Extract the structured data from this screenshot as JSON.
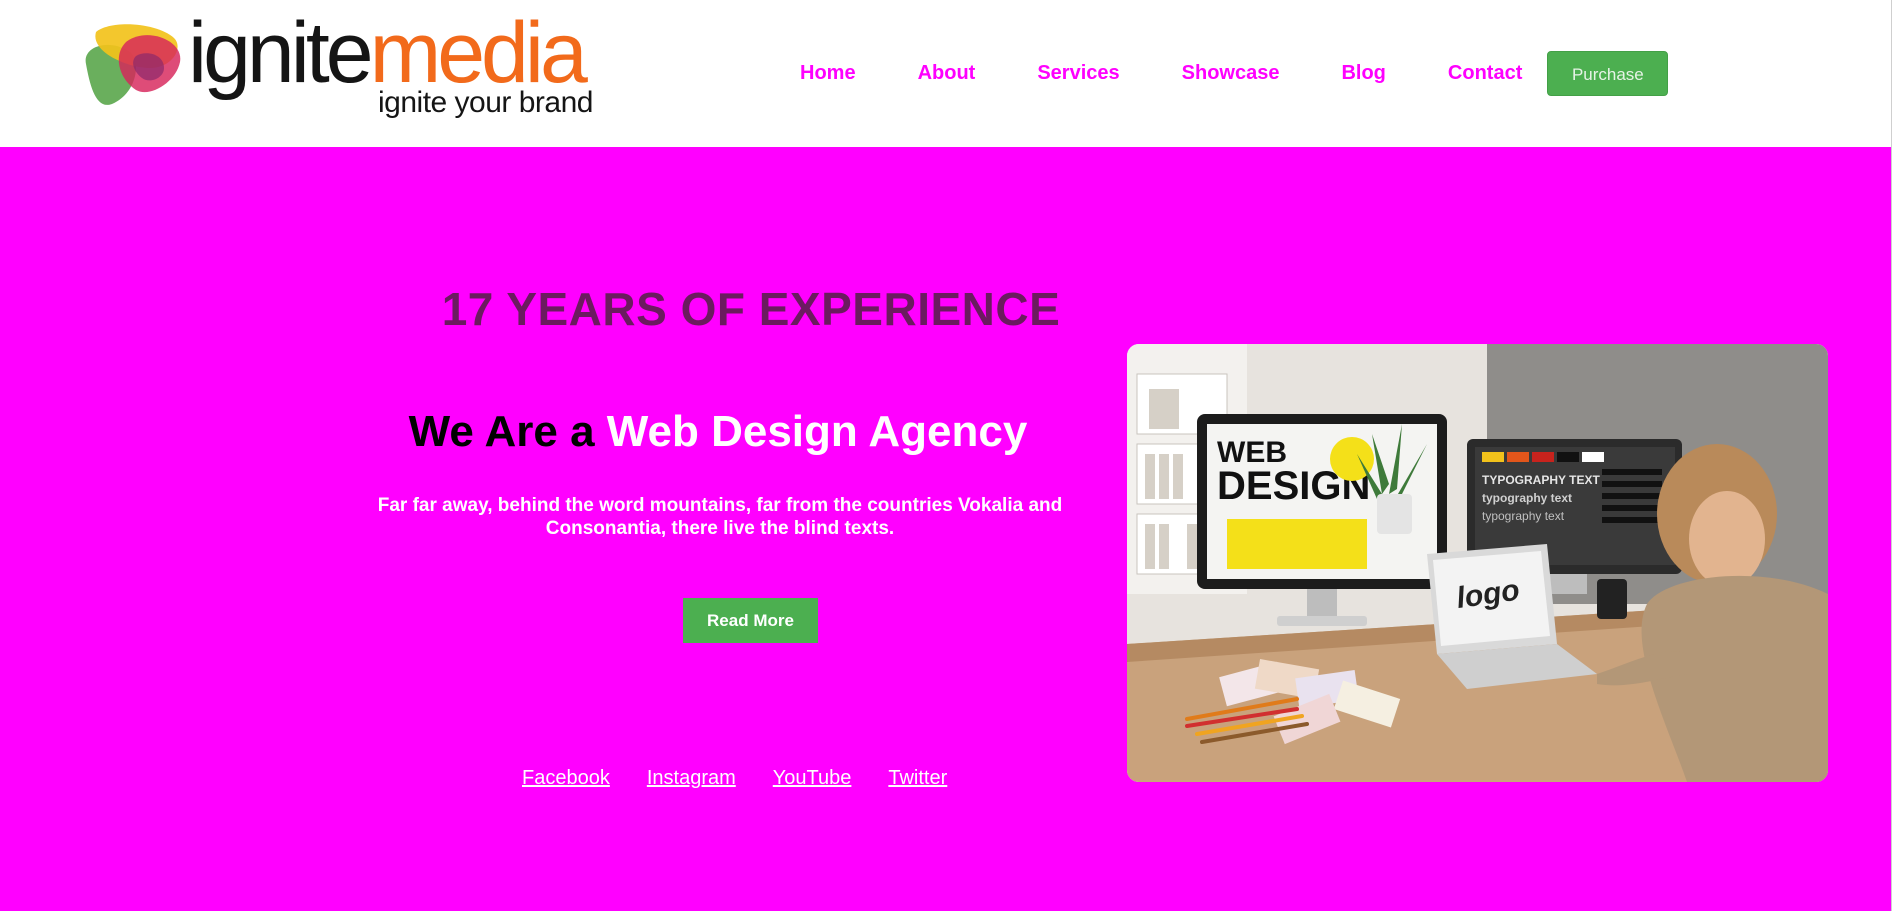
{
  "brand": {
    "name_part1": "ignite",
    "name_part2": "media",
    "tagline": "ignite your brand"
  },
  "nav": {
    "items": [
      "Home",
      "About",
      "Services",
      "Showcase",
      "Blog",
      "Contact"
    ],
    "purchase_label": "Purchase"
  },
  "hero": {
    "experience": "17 YEARS OF EXPERIENCE",
    "headline_dark": "We Are a",
    "headline_light": "Web Design Agency",
    "blurb": "Far far away, behind the word mountains, far from the countries Vokalia and Consonantia, there live the blind texts.",
    "read_more_label": "Read More",
    "social": [
      "Facebook",
      "Instagram",
      "YouTube",
      "Twitter"
    ]
  },
  "image": {
    "monitor_title_1": "WEB",
    "monitor_title_2": "DESIGN",
    "monitor2_line1": "TYPOGRAPHY TEXT",
    "monitor2_line2": "typography text",
    "monitor2_line3": "typography text",
    "laptop_text": "logo"
  },
  "colors": {
    "hero_bg": "#ff00ff",
    "nav_link": "#ff00ff",
    "button_green": "#4caf50",
    "experience_text": "#6b1b5f",
    "logo_orange": "#f26a1b"
  }
}
